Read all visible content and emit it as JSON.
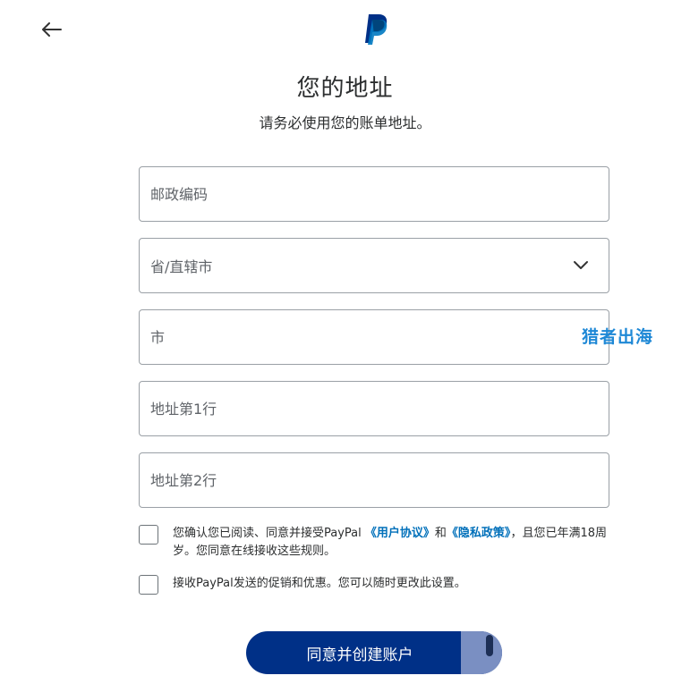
{
  "header": {
    "back_icon": "arrow-left-icon",
    "logo_icon": "paypal-logo-icon",
    "title": "您的地址",
    "subtitle": "请务必使用您的账单地址。"
  },
  "form": {
    "postal_code": {
      "placeholder": "邮政编码",
      "value": ""
    },
    "province": {
      "label": "省/直辖市",
      "icon": "chevron-down-icon"
    },
    "city": {
      "placeholder": "市",
      "value": ""
    },
    "address_line1": {
      "placeholder": "地址第1行",
      "value": ""
    },
    "address_line2": {
      "placeholder": "地址第2行",
      "value": ""
    }
  },
  "watermark": "猎者出海",
  "agreements": {
    "terms": {
      "checked": false,
      "text_before": "您确认您已阅读、同意并接受PayPal",
      "user_agreement_link": "《用户协议》",
      "connector": "和",
      "privacy_link": "《隐私政策》",
      "text_after": "，且您已年满18周岁。您同意在线接收这些规则。"
    },
    "marketing": {
      "checked": false,
      "text": "接收PayPal发送的促销和优惠。您可以随时更改此设置。"
    }
  },
  "submit_label": "同意并创建账户",
  "colors": {
    "primary_button": "#003087",
    "link": "#0070ba",
    "watermark": "#1e88d6",
    "border": "#9aa0a6"
  }
}
